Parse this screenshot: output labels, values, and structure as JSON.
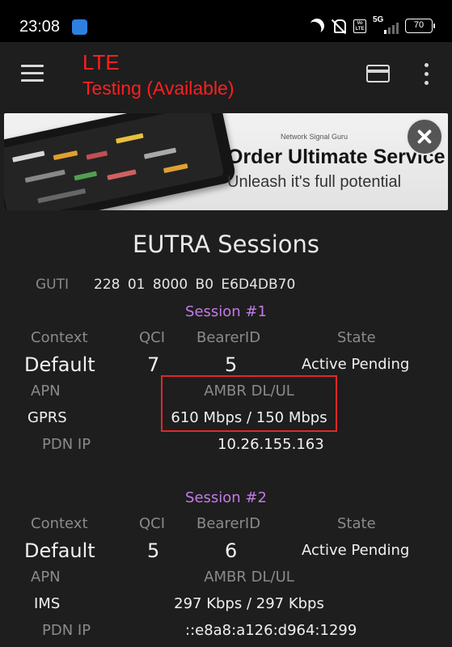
{
  "status_bar": {
    "time": "23:08",
    "volte_label": "Vo LTE",
    "network_label": "5G",
    "battery": "70",
    "icons": [
      "app-notification-icon",
      "moon-icon",
      "mute-icon",
      "volte-icon",
      "signal-icon",
      "battery-icon"
    ]
  },
  "toolbar": {
    "title": "LTE",
    "subtitle": "Testing (Available)",
    "title_color": "#ff1f1f",
    "icons": [
      "menu-icon",
      "card-icon",
      "more-vert-icon"
    ]
  },
  "ad": {
    "brand": "Network Signal Guru",
    "headline": "Order Ultimate Service",
    "subline": "Unleash it's full potential",
    "icons": [
      "close-icon"
    ]
  },
  "page": {
    "title": "EUTRA Sessions",
    "guti_label": "GUTI",
    "guti_value": "228  01  8000  B0  E6D4DB70"
  },
  "headers": {
    "context": "Context",
    "qci": "QCI",
    "bearer_id": "BearerID",
    "state": "State",
    "apn": "APN",
    "ambr": "AMBR DL/UL",
    "pdn_ip": "PDN IP"
  },
  "sessions": [
    {
      "title": "Session #1",
      "context": "Default",
      "qci": "7",
      "bearer_id": "5",
      "state": "Active Pending",
      "apn": "GPRS",
      "ambr": "610 Mbps / 150 Mbps",
      "pdn_ip": "10.26.155.163"
    },
    {
      "title": "Session #2",
      "context": "Default",
      "qci": "5",
      "bearer_id": "6",
      "state": "Active Pending",
      "apn": "IMS",
      "ambr": "297 Kbps / 297 Kbps",
      "pdn_ip": "::e8a8:a126:d964:1299"
    }
  ],
  "colors": {
    "background": "#1e1e1e",
    "session_title": "#c47ae8",
    "label": "#8a8a8a",
    "highlight": "#e02828"
  }
}
